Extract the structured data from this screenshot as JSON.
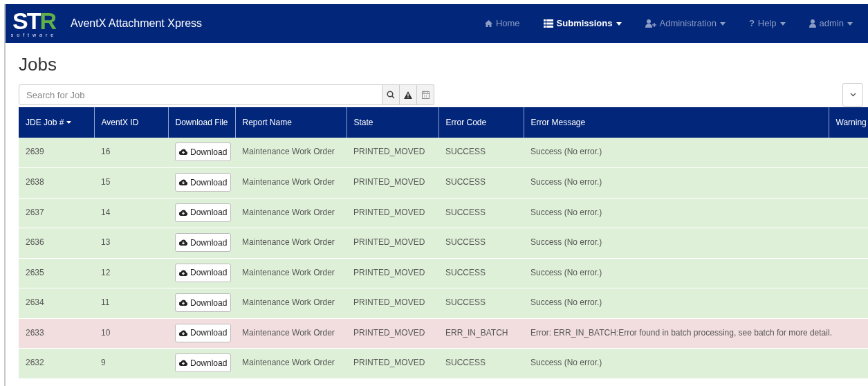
{
  "navbar": {
    "logo": {
      "letters": "ST",
      "accent": "R",
      "tagline": "software"
    },
    "app_title": "AventX Attachment Xpress",
    "items": [
      {
        "label": "Home",
        "dropdown": false,
        "selected": false
      },
      {
        "label": "Submissions",
        "dropdown": true,
        "selected": true
      },
      {
        "label": "Administration",
        "dropdown": true,
        "selected": false
      },
      {
        "label": "Help",
        "glyph": "?",
        "dropdown": true,
        "selected": false
      },
      {
        "label": "admin",
        "dropdown": true,
        "selected": false
      }
    ]
  },
  "page_title": "Jobs",
  "search": {
    "placeholder": "Search for Job"
  },
  "table": {
    "columns": [
      {
        "label": "JDE Job #",
        "sorted": true
      },
      {
        "label": "AventX ID",
        "sorted": false
      },
      {
        "label": "Download File",
        "sorted": false
      },
      {
        "label": "Report Name",
        "sorted": false
      },
      {
        "label": "State",
        "sorted": false
      },
      {
        "label": "Error Code",
        "sorted": false
      },
      {
        "label": "Error Message",
        "sorted": false
      },
      {
        "label": "Warning",
        "sorted": false
      }
    ],
    "rows": [
      {
        "kind": "success",
        "job": "2639",
        "id": "16",
        "download": "Download",
        "report": "Maintenance Work Order",
        "state": "PRINTED_MOVED",
        "code": "SUCCESS",
        "message": "Success (No error.)"
      },
      {
        "kind": "success",
        "job": "2638",
        "id": "15",
        "download": "Download",
        "report": "Maintenance Work Order",
        "state": "PRINTED_MOVED",
        "code": "SUCCESS",
        "message": "Success (No error.)"
      },
      {
        "kind": "success",
        "job": "2637",
        "id": "14",
        "download": "Download",
        "report": "Maintenance Work Order",
        "state": "PRINTED_MOVED",
        "code": "SUCCESS",
        "message": "Success (No error.)"
      },
      {
        "kind": "success",
        "job": "2636",
        "id": "13",
        "download": "Download",
        "report": "Maintenance Work Order",
        "state": "PRINTED_MOVED",
        "code": "SUCCESS",
        "message": "Success (No error.)"
      },
      {
        "kind": "success",
        "job": "2635",
        "id": "12",
        "download": "Download",
        "report": "Maintenance Work Order",
        "state": "PRINTED_MOVED",
        "code": "SUCCESS",
        "message": "Success (No error.)"
      },
      {
        "kind": "success",
        "job": "2634",
        "id": "11",
        "download": "Download",
        "report": "Maintenance Work Order",
        "state": "PRINTED_MOVED",
        "code": "SUCCESS",
        "message": "Success (No error.)"
      },
      {
        "kind": "error",
        "job": "2633",
        "id": "10",
        "download": "Download",
        "report": "Maintenance Work Order",
        "state": "PRINTED_MOVED",
        "code": "ERR_IN_BATCH",
        "message": "Error: ERR_IN_BATCH:Error found in batch processing, see batch for more detail."
      },
      {
        "kind": "success",
        "job": "2632",
        "id": "9",
        "download": "Download",
        "report": "Maintenance Work Order",
        "state": "PRINTED_MOVED",
        "code": "SUCCESS",
        "message": "Success (No error.)"
      }
    ]
  }
}
